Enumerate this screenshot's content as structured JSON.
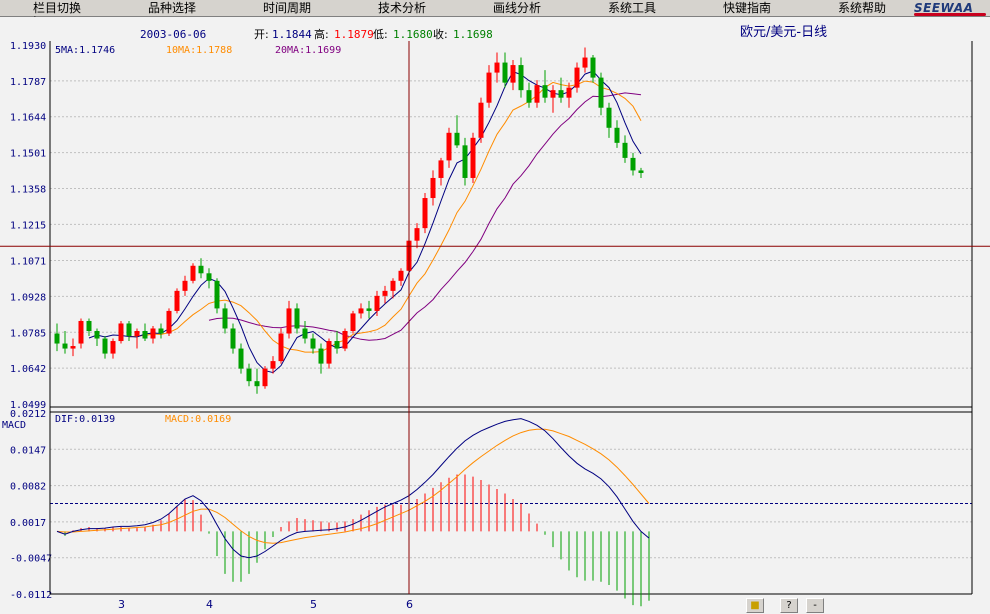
{
  "menu": [
    "栏目切换",
    "品种选择",
    "时间周期",
    "技术分析",
    "画线分析",
    "系统工具",
    "快键指南",
    "系统帮助"
  ],
  "logo": "SEEWAA",
  "info": {
    "date": "2003-06-06",
    "open_label": "开:",
    "open": "1.1844",
    "high_label": "高:",
    "high": "1.1879",
    "low_label": "低:",
    "low": "1.1680",
    "close_label": "收:",
    "close": "1.1698",
    "title": "欧元/美元-日线"
  },
  "ma_legend": {
    "ma5": "5MA:1.1746",
    "ma10": "10MA:1.1788",
    "ma20": "20MA:1.1699"
  },
  "macd_legend": {
    "name": "MACD",
    "dif": "DIF:0.0139",
    "macd": "MACD:0.0169"
  },
  "status": {
    "btn1": "■",
    "btn2": "?",
    "btn3": "-"
  },
  "colors": {
    "up": "#ff0000",
    "down": "#00a000",
    "ma5": "#000080",
    "ma10": "#ff8c00",
    "ma20": "#800080",
    "crosshair": "#8b0000",
    "grid": "#c0c0c0",
    "dif": "#000080",
    "dea": "#ff8c00"
  },
  "chart_data": {
    "type": "candlestick",
    "price_axis": {
      "ticks": [
        1.193,
        1.1787,
        1.1644,
        1.1501,
        1.1358,
        1.1215,
        1.1071,
        1.0928,
        1.0785,
        1.0642,
        1.0499
      ],
      "range": [
        1.0499,
        1.193
      ]
    },
    "macd_axis": {
      "ticks": [
        0.0212,
        0.0147,
        0.0082,
        0.0017,
        -0.0047,
        -0.0112
      ],
      "range": [
        -0.0112,
        0.0212
      ]
    },
    "x_labels": [
      {
        "label": "3",
        "index": 8
      },
      {
        "label": "4",
        "index": 19
      },
      {
        "label": "5",
        "index": 32
      },
      {
        "label": "6",
        "index": 44
      }
    ],
    "crosshair": {
      "index": 44,
      "price": 1.1128
    },
    "macd_reference": 0.005,
    "candles": [
      [
        1.078,
        1.082,
        1.071,
        1.074
      ],
      [
        1.074,
        1.079,
        1.07,
        1.072
      ],
      [
        1.072,
        1.076,
        1.069,
        1.073
      ],
      [
        1.074,
        1.084,
        1.072,
        1.083
      ],
      [
        1.083,
        1.084,
        1.077,
        1.079
      ],
      [
        1.079,
        1.08,
        1.073,
        1.076
      ],
      [
        1.076,
        1.077,
        1.068,
        1.07
      ],
      [
        1.07,
        1.076,
        1.068,
        1.075
      ],
      [
        1.075,
        1.083,
        1.074,
        1.082
      ],
      [
        1.082,
        1.083,
        1.075,
        1.077
      ],
      [
        1.077,
        1.08,
        1.072,
        1.079
      ],
      [
        1.079,
        1.082,
        1.075,
        1.076
      ],
      [
        1.076,
        1.081,
        1.074,
        1.08
      ],
      [
        1.08,
        1.082,
        1.076,
        1.078
      ],
      [
        1.078,
        1.088,
        1.077,
        1.087
      ],
      [
        1.087,
        1.096,
        1.086,
        1.095
      ],
      [
        1.095,
        1.101,
        1.093,
        1.099
      ],
      [
        1.099,
        1.106,
        1.098,
        1.105
      ],
      [
        1.105,
        1.108,
        1.1,
        1.102
      ],
      [
        1.102,
        1.104,
        1.096,
        1.099
      ],
      [
        1.099,
        1.1,
        1.086,
        1.088
      ],
      [
        1.088,
        1.09,
        1.078,
        1.08
      ],
      [
        1.08,
        1.082,
        1.07,
        1.072
      ],
      [
        1.072,
        1.074,
        1.062,
        1.064
      ],
      [
        1.064,
        1.066,
        1.057,
        1.059
      ],
      [
        1.059,
        1.064,
        1.054,
        1.057
      ],
      [
        1.057,
        1.065,
        1.056,
        1.064
      ],
      [
        1.064,
        1.069,
        1.062,
        1.067
      ],
      [
        1.067,
        1.08,
        1.066,
        1.078
      ],
      [
        1.078,
        1.091,
        1.076,
        1.088
      ],
      [
        1.088,
        1.09,
        1.078,
        1.08
      ],
      [
        1.08,
        1.083,
        1.074,
        1.076
      ],
      [
        1.076,
        1.078,
        1.07,
        1.072
      ],
      [
        1.072,
        1.074,
        1.062,
        1.066
      ],
      [
        1.066,
        1.076,
        1.064,
        1.075
      ],
      [
        1.075,
        1.079,
        1.07,
        1.072
      ],
      [
        1.072,
        1.08,
        1.071,
        1.079
      ],
      [
        1.079,
        1.087,
        1.078,
        1.086
      ],
      [
        1.086,
        1.09,
        1.084,
        1.088
      ],
      [
        1.088,
        1.091,
        1.084,
        1.087
      ],
      [
        1.087,
        1.095,
        1.085,
        1.093
      ],
      [
        1.093,
        1.097,
        1.09,
        1.095
      ],
      [
        1.095,
        1.1,
        1.092,
        1.099
      ],
      [
        1.099,
        1.104,
        1.097,
        1.103
      ],
      [
        1.103,
        1.116,
        1.101,
        1.115
      ],
      [
        1.115,
        1.122,
        1.112,
        1.12
      ],
      [
        1.12,
        1.134,
        1.118,
        1.132
      ],
      [
        1.132,
        1.143,
        1.129,
        1.14
      ],
      [
        1.14,
        1.148,
        1.137,
        1.147
      ],
      [
        1.147,
        1.16,
        1.144,
        1.158
      ],
      [
        1.158,
        1.165,
        1.152,
        1.153
      ],
      [
        1.153,
        1.156,
        1.137,
        1.14
      ],
      [
        1.14,
        1.158,
        1.138,
        1.156
      ],
      [
        1.156,
        1.172,
        1.154,
        1.17
      ],
      [
        1.17,
        1.185,
        1.168,
        1.182
      ],
      [
        1.182,
        1.19,
        1.178,
        1.186
      ],
      [
        1.186,
        1.19,
        1.176,
        1.178
      ],
      [
        1.178,
        1.187,
        1.175,
        1.185
      ],
      [
        1.185,
        1.188,
        1.172,
        1.175
      ],
      [
        1.175,
        1.178,
        1.168,
        1.17
      ],
      [
        1.17,
        1.179,
        1.168,
        1.177
      ],
      [
        1.177,
        1.183,
        1.17,
        1.172
      ],
      [
        1.172,
        1.177,
        1.166,
        1.175
      ],
      [
        1.175,
        1.18,
        1.17,
        1.172
      ],
      [
        1.172,
        1.178,
        1.168,
        1.176
      ],
      [
        1.176,
        1.186,
        1.174,
        1.184
      ],
      [
        1.184,
        1.192,
        1.182,
        1.188
      ],
      [
        1.188,
        1.189,
        1.178,
        1.18
      ],
      [
        1.18,
        1.182,
        1.165,
        1.168
      ],
      [
        1.168,
        1.17,
        1.156,
        1.16
      ],
      [
        1.16,
        1.163,
        1.152,
        1.154
      ],
      [
        1.154,
        1.157,
        1.146,
        1.148
      ],
      [
        1.148,
        1.15,
        1.141,
        1.143
      ],
      [
        1.143,
        1.144,
        1.14,
        1.142
      ]
    ],
    "ma5": [
      null,
      null,
      null,
      null,
      1.0762,
      1.0774,
      1.0766,
      1.0774,
      1.0772,
      1.0768,
      1.0766,
      1.0778,
      1.0782,
      1.078,
      1.08,
      1.0832,
      1.0878,
      1.0928,
      1.0972,
      1.1,
      1.0986,
      1.0948,
      1.0882,
      1.081,
      1.0726,
      1.0664,
      1.0632,
      1.0624,
      1.0652,
      1.071,
      1.0764,
      1.078,
      1.0788,
      1.0764,
      1.0738,
      1.0722,
      1.0728,
      1.0766,
      1.08,
      1.0836,
      1.0868,
      1.0898,
      1.0926,
      1.0954,
      1.1024,
      1.1064,
      1.1138,
      1.122,
      1.1308,
      1.1394,
      1.146,
      1.1476,
      1.1518,
      1.1562,
      1.1622,
      1.1688,
      1.1764,
      1.1824,
      1.1812,
      1.1788,
      1.177,
      1.1758,
      1.1738,
      1.1732,
      1.1744,
      1.1774,
      1.1814,
      1.1826,
      1.179,
      1.176,
      1.17,
      1.162,
      1.1546,
      1.1496
    ],
    "ma10": [
      null,
      null,
      null,
      null,
      null,
      null,
      null,
      null,
      null,
      1.0766,
      1.077,
      1.0772,
      1.0778,
      1.0776,
      1.0784,
      1.0799,
      1.0828,
      1.0855,
      1.0876,
      1.09,
      1.0909,
      1.0913,
      1.0905,
      1.0891,
      1.0863,
      1.0832,
      1.079,
      1.0753,
      1.0731,
      1.0718,
      1.0714,
      1.0706,
      1.0706,
      1.0708,
      1.0724,
      1.0743,
      1.0754,
      1.0777,
      1.0782,
      1.0787,
      1.0795,
      1.0813,
      1.0846,
      1.0877,
      1.093,
      1.0981,
      1.1018,
      1.1073,
      1.1131,
      1.1193,
      1.1262,
      1.1307,
      1.1369,
      1.1435,
      1.1508,
      1.1574,
      1.162,
      1.1671,
      1.1687,
      1.1705,
      1.1729,
      1.1761,
      1.1781,
      1.1772,
      1.1766,
      1.1772,
      1.1786,
      1.1782,
      1.1761,
      1.1752,
      1.1737,
      1.1717,
      1.1686,
      1.1628
    ],
    "ma20": [
      null,
      null,
      null,
      null,
      null,
      null,
      null,
      null,
      null,
      null,
      null,
      null,
      null,
      null,
      null,
      null,
      null,
      null,
      null,
      1.0833,
      1.084,
      1.0842,
      1.0841,
      1.0834,
      1.0824,
      1.0815,
      1.0809,
      1.0804,
      1.0803,
      1.0809,
      1.0811,
      1.0809,
      1.0806,
      1.08,
      1.0793,
      1.0788,
      1.0772,
      1.0765,
      1.0757,
      1.0753,
      1.0755,
      1.076,
      1.0777,
      1.0793,
      1.0828,
      1.0862,
      1.0886,
      1.0915,
      1.0956,
      1.099,
      1.1028,
      1.1063,
      1.1107,
      1.1156,
      1.1219,
      1.1277,
      1.132,
      1.1375,
      1.1409,
      1.1449,
      1.1496,
      1.1535,
      1.1575,
      1.161,
      1.1637,
      1.1673,
      1.1703,
      1.1726,
      1.1724,
      1.1728,
      1.1733,
      1.1739,
      1.1736,
      1.1732
    ],
    "dif": [
      0.0,
      -0.0005,
      0.0,
      0.0003,
      0.0005,
      0.0005,
      0.0006,
      0.0008,
      0.0009,
      0.0009,
      0.001,
      0.0012,
      0.0016,
      0.0022,
      0.0032,
      0.0045,
      0.0058,
      0.0064,
      0.0055,
      0.0038,
      0.0012,
      -0.0013,
      -0.0032,
      -0.0044,
      -0.0047,
      -0.0044,
      -0.0036,
      -0.0026,
      -0.0016,
      -0.0008,
      -0.0002,
      0.0,
      0.0001,
      0.0002,
      0.0003,
      0.0005,
      0.0008,
      0.0013,
      0.002,
      0.0028,
      0.0036,
      0.0044,
      0.005,
      0.0056,
      0.0064,
      0.0075,
      0.0088,
      0.0102,
      0.0118,
      0.0134,
      0.0149,
      0.0162,
      0.0172,
      0.018,
      0.0186,
      0.0192,
      0.0197,
      0.02,
      0.0202,
      0.0197,
      0.019,
      0.018,
      0.0166,
      0.015,
      0.0135,
      0.0122,
      0.0112,
      0.0104,
      0.0094,
      0.008,
      0.0062,
      0.004,
      0.0018,
      0.0,
      -0.0012
    ],
    "dea": [
      0.0,
      -0.0001,
      -0.0001,
      0.0,
      0.0001,
      0.0002,
      0.0003,
      0.0004,
      0.0005,
      0.0006,
      0.0007,
      0.0008,
      0.001,
      0.0012,
      0.0016,
      0.0022,
      0.0029,
      0.0036,
      0.004,
      0.004,
      0.0034,
      0.0025,
      0.0013,
      0.0001,
      -0.0009,
      -0.0016,
      -0.002,
      -0.0021,
      -0.002,
      -0.0017,
      -0.0014,
      -0.0011,
      -0.0009,
      -0.0007,
      -0.0005,
      -0.0003,
      -0.0001,
      0.0002,
      0.0005,
      0.0009,
      0.0014,
      0.002,
      0.0026,
      0.0032,
      0.0038,
      0.0046,
      0.0054,
      0.0063,
      0.0074,
      0.0086,
      0.0098,
      0.0111,
      0.0123,
      0.0134,
      0.0144,
      0.0154,
      0.0163,
      0.0171,
      0.0177,
      0.0181,
      0.0183,
      0.0183,
      0.018,
      0.0175,
      0.017,
      0.0163,
      0.0156,
      0.0148,
      0.0139,
      0.0128,
      0.0115,
      0.01,
      0.0084,
      0.0067,
      0.005
    ]
  }
}
